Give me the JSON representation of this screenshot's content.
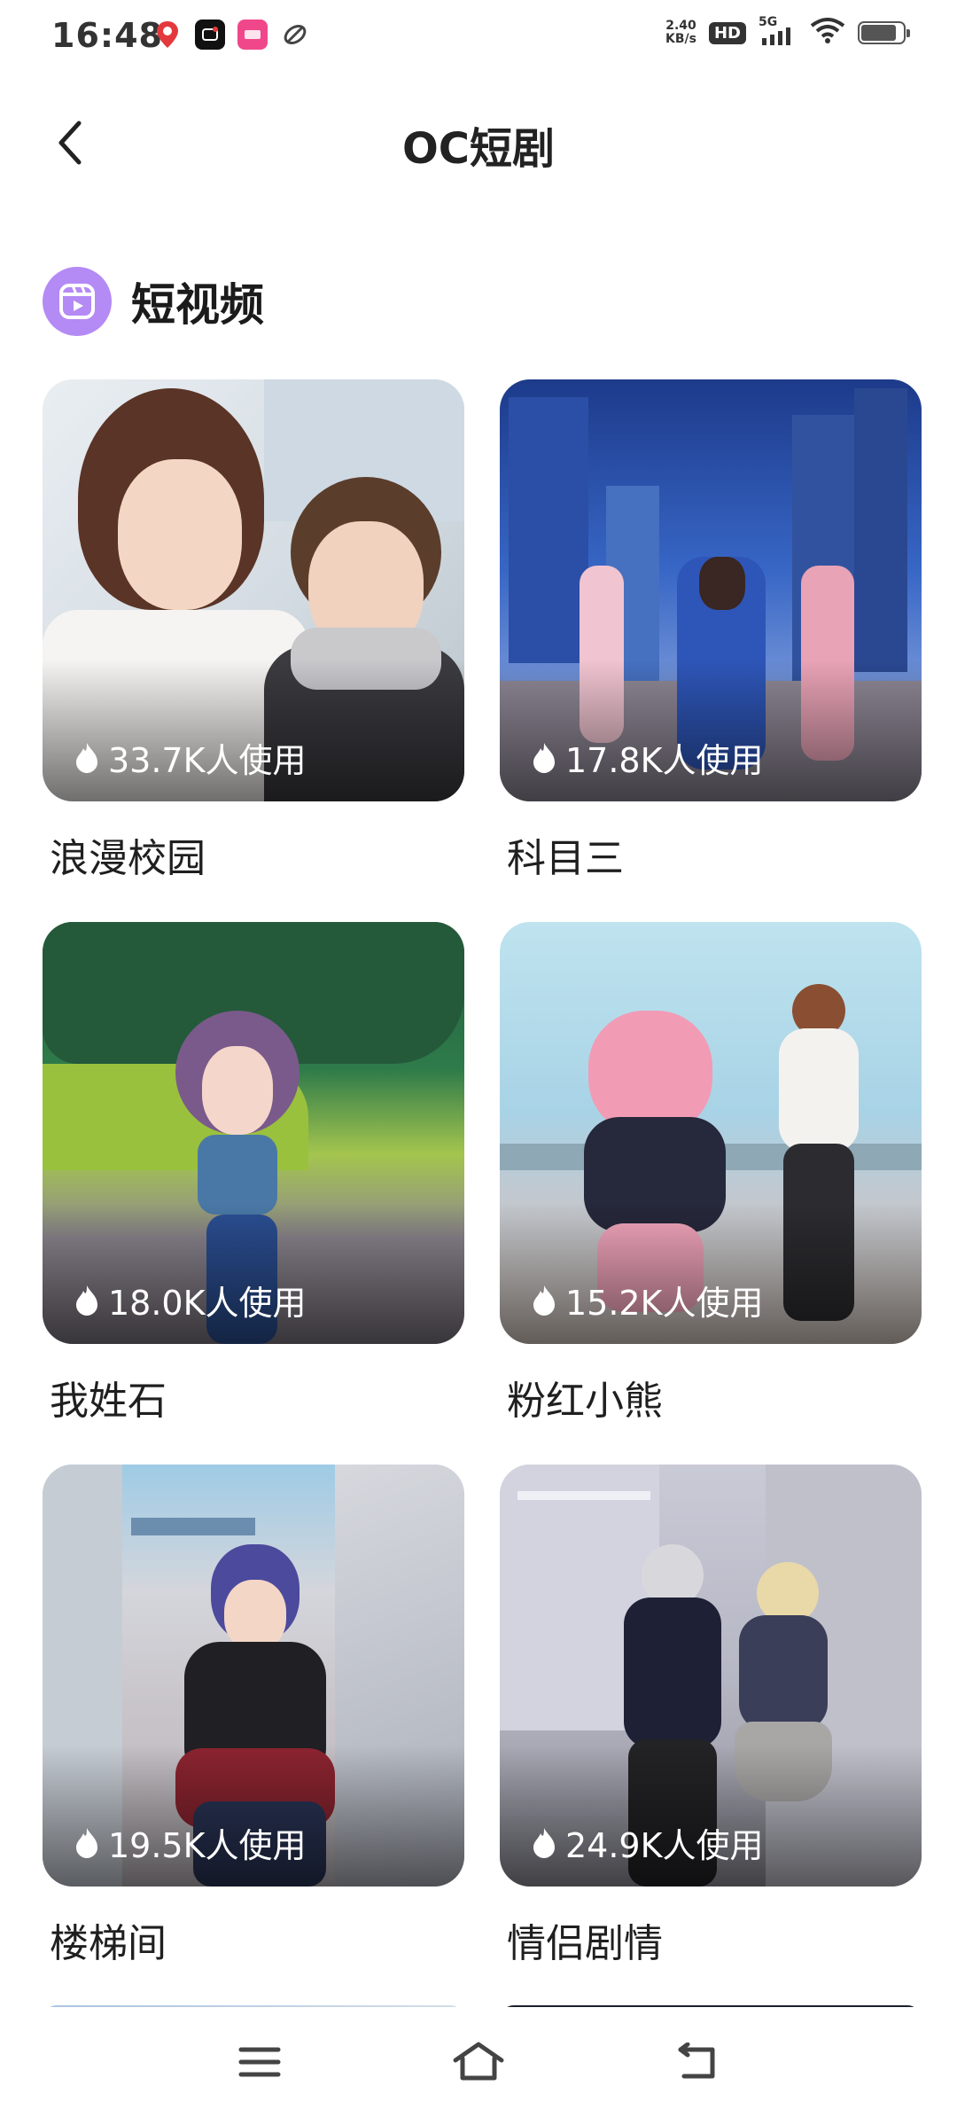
{
  "status_bar": {
    "time": "16:48",
    "net_speed_value": "2.40",
    "net_speed_unit": "KB/s",
    "hd": "HD",
    "network": "5G",
    "battery_level": 0.85,
    "notification_icons": [
      "location-pin-icon",
      "video-app-icon",
      "pink-app-icon",
      "leaf-app-icon"
    ]
  },
  "header": {
    "back_icon": "chevron-left-icon",
    "title": "OC短剧"
  },
  "section": {
    "icon": "video-reel-icon",
    "title": "短视频"
  },
  "cards": [
    {
      "title": "浪漫校园",
      "usage": "33.7K人使用"
    },
    {
      "title": "科目三",
      "usage": "17.8K人使用"
    },
    {
      "title": "我姓石",
      "usage": "18.0K人使用"
    },
    {
      "title": "粉红小熊",
      "usage": "15.2K人使用"
    },
    {
      "title": "楼梯间",
      "usage": "19.5K人使用"
    },
    {
      "title": "情侣剧情",
      "usage": "24.9K人使用"
    }
  ],
  "nav": {
    "menu_icon": "menu-icon",
    "home_icon": "home-icon",
    "back_icon": "back-return-icon"
  }
}
